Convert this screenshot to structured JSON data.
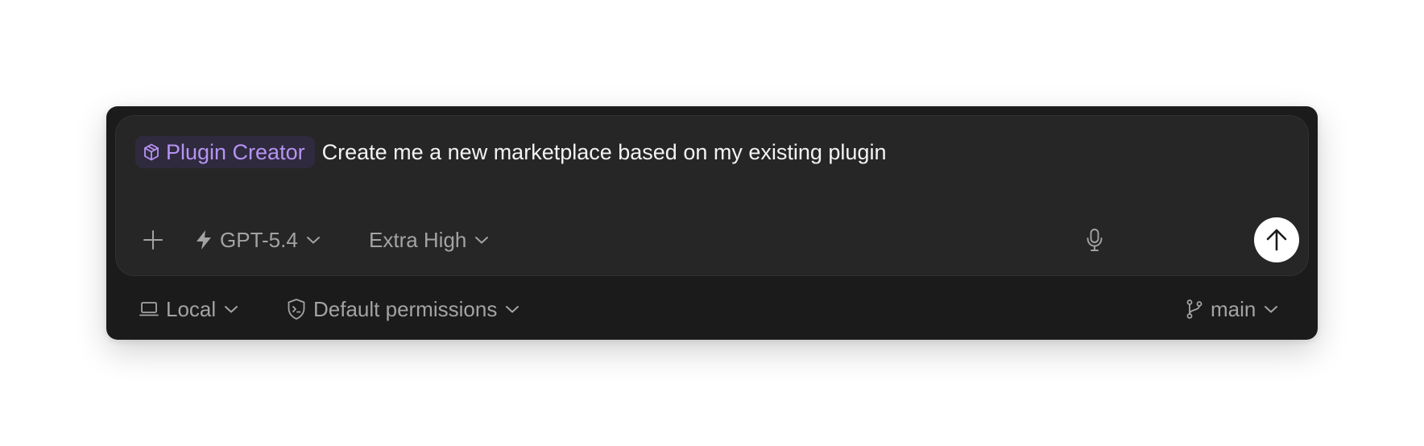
{
  "composer": {
    "skill_chip": {
      "label": "Plugin Creator",
      "icon": "cube-icon",
      "color": "#b693f3"
    },
    "prompt": "Create me a new marketplace based on my existing plugin"
  },
  "toolbar": {
    "attach_icon": "plus-icon",
    "model": {
      "label": "GPT-5.4",
      "icon": "lightning-icon"
    },
    "reasoning": {
      "label": "Extra High"
    },
    "mic_icon": "microphone-icon",
    "send_icon": "arrow-up-icon"
  },
  "footer": {
    "environment": {
      "label": "Local",
      "icon": "laptop-icon"
    },
    "permissions": {
      "label": "Default permissions",
      "icon": "shield-terminal-icon"
    },
    "branch": {
      "label": "main",
      "icon": "git-branch-icon"
    }
  },
  "colors": {
    "panel_bg": "#1b1b1b",
    "composer_bg": "#262626",
    "chip_bg": "#2f2a3d",
    "accent": "#b693f3",
    "muted_text": "#a3a3a3"
  }
}
